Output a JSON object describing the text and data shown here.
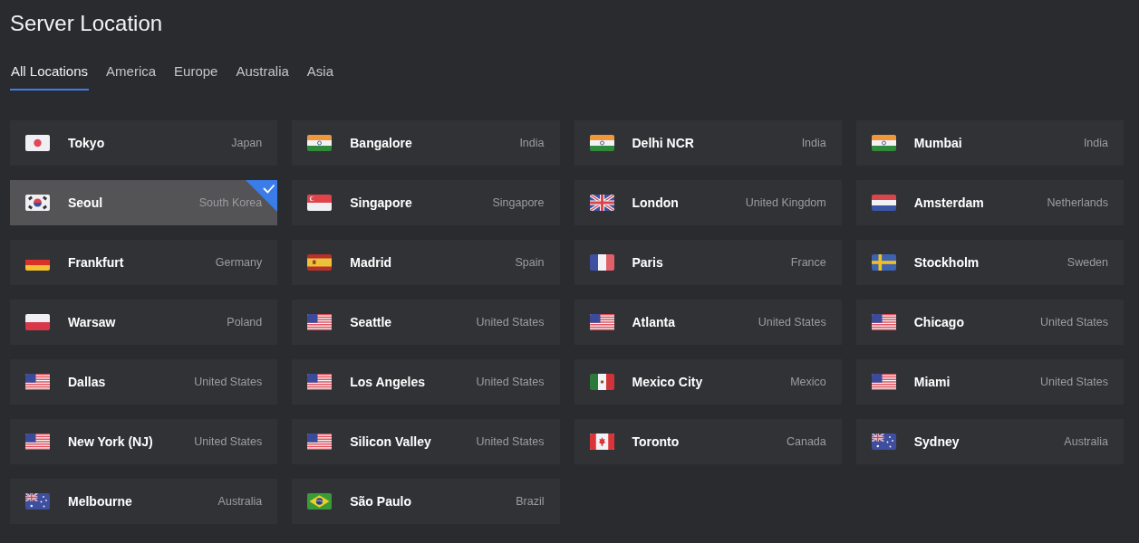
{
  "page": {
    "title": "Server Location"
  },
  "tabs": [
    {
      "label": "All Locations",
      "selected": true
    },
    {
      "label": "America",
      "selected": false
    },
    {
      "label": "Europe",
      "selected": false
    },
    {
      "label": "Australia",
      "selected": false
    },
    {
      "label": "Asia",
      "selected": false
    }
  ],
  "locations": [
    {
      "city": "Tokyo",
      "country": "Japan",
      "kind": "japan",
      "selected": false
    },
    {
      "city": "Bangalore",
      "country": "India",
      "kind": "india",
      "selected": false
    },
    {
      "city": "Delhi NCR",
      "country": "India",
      "kind": "india",
      "selected": false
    },
    {
      "city": "Mumbai",
      "country": "India",
      "kind": "india",
      "selected": false
    },
    {
      "city": "Seoul",
      "country": "South Korea",
      "kind": "korea",
      "selected": true
    },
    {
      "city": "Singapore",
      "country": "Singapore",
      "kind": "singapore",
      "selected": false
    },
    {
      "city": "London",
      "country": "United Kingdom",
      "kind": "uk",
      "selected": false
    },
    {
      "city": "Amsterdam",
      "country": "Netherlands",
      "kind": "netherlands",
      "selected": false
    },
    {
      "city": "Frankfurt",
      "country": "Germany",
      "kind": "germany",
      "selected": false
    },
    {
      "city": "Madrid",
      "country": "Spain",
      "kind": "spain",
      "selected": false
    },
    {
      "city": "Paris",
      "country": "France",
      "kind": "france",
      "selected": false
    },
    {
      "city": "Stockholm",
      "country": "Sweden",
      "kind": "sweden",
      "selected": false
    },
    {
      "city": "Warsaw",
      "country": "Poland",
      "kind": "poland",
      "selected": false
    },
    {
      "city": "Seattle",
      "country": "United States",
      "kind": "usa",
      "selected": false
    },
    {
      "city": "Atlanta",
      "country": "United States",
      "kind": "usa",
      "selected": false
    },
    {
      "city": "Chicago",
      "country": "United States",
      "kind": "usa",
      "selected": false
    },
    {
      "city": "Dallas",
      "country": "United States",
      "kind": "usa",
      "selected": false
    },
    {
      "city": "Los Angeles",
      "country": "United States",
      "kind": "usa",
      "selected": false
    },
    {
      "city": "Mexico City",
      "country": "Mexico",
      "kind": "mexico",
      "selected": false
    },
    {
      "city": "Miami",
      "country": "United States",
      "kind": "usa",
      "selected": false
    },
    {
      "city": "New York (NJ)",
      "country": "United States",
      "kind": "usa",
      "selected": false
    },
    {
      "city": "Silicon Valley",
      "country": "United States",
      "kind": "usa",
      "selected": false
    },
    {
      "city": "Toronto",
      "country": "Canada",
      "kind": "canada",
      "selected": false
    },
    {
      "city": "Sydney",
      "country": "Australia",
      "kind": "australia",
      "selected": false
    },
    {
      "city": "Melbourne",
      "country": "Australia",
      "kind": "australia",
      "selected": false
    },
    {
      "city": "São Paulo",
      "country": "Brazil",
      "kind": "brazil",
      "selected": false
    }
  ]
}
